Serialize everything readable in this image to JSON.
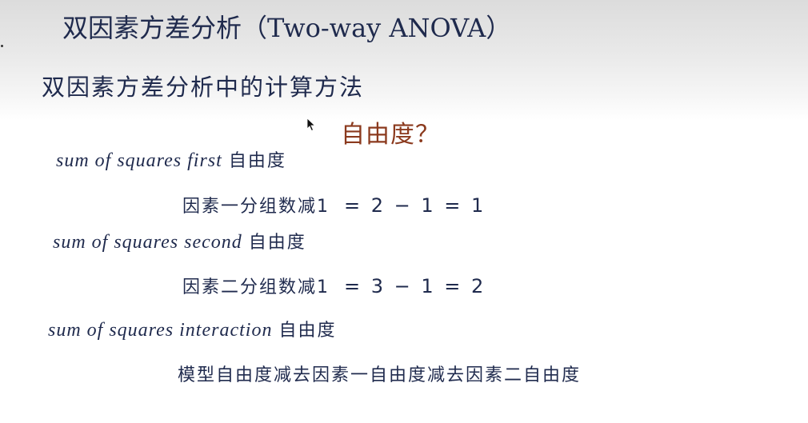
{
  "slide": {
    "title": "双因素方差分析（Two-way ANOVA）",
    "subtitle": "双因素方差分析中的计算方法",
    "question": "自由度？"
  },
  "items": [
    {
      "term": "sum of squares first",
      "unit": "自由度",
      "formula_text": "因素一分组数减1",
      "formula_eq": "= 2 − 1 = 1"
    },
    {
      "term": "sum of squares second",
      "unit": "自由度",
      "formula_text": "因素二分组数减1",
      "formula_eq": "= 3 − 1 = 2"
    },
    {
      "term": "sum of squares interaction",
      "unit": "自由度",
      "formula_text": "模型自由度减去因素一自由度减去因素二自由度",
      "formula_eq": ""
    }
  ],
  "colors": {
    "text": "#1f2a4d",
    "accent": "#8b3a1e"
  },
  "icons": {
    "cursor": "mouse-pointer-icon"
  }
}
